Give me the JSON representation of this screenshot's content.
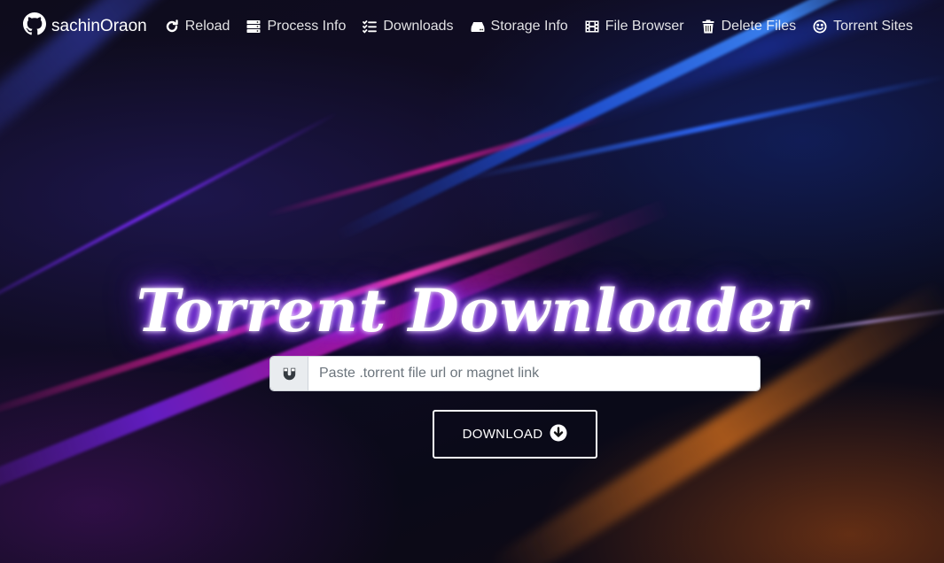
{
  "navbar": {
    "brand": {
      "label": "sachinOraon",
      "icon": "github-icon"
    },
    "items": [
      {
        "label": "Reload",
        "icon": "reload-icon"
      },
      {
        "label": "Process Info",
        "icon": "server-icon"
      },
      {
        "label": "Downloads",
        "icon": "tasks-icon"
      },
      {
        "label": "Storage Info",
        "icon": "hdd-icon"
      },
      {
        "label": "File Browser",
        "icon": "film-icon"
      },
      {
        "label": "Delete Files",
        "icon": "trash-icon"
      },
      {
        "label": "Torrent Sites",
        "icon": "smile-icon"
      }
    ]
  },
  "hero": {
    "title": "Torrent Downloader",
    "input": {
      "placeholder": "Paste .torrent file url or magnet link",
      "value": "",
      "addon_icon": "magnet-icon"
    },
    "download_button": {
      "label": "DOWNLOAD",
      "icon": "arrow-circle-down-icon"
    }
  },
  "colors": {
    "title_glow": "#7a2bff",
    "button_border": "#ffffff",
    "addon_background": "#e9ecef"
  }
}
